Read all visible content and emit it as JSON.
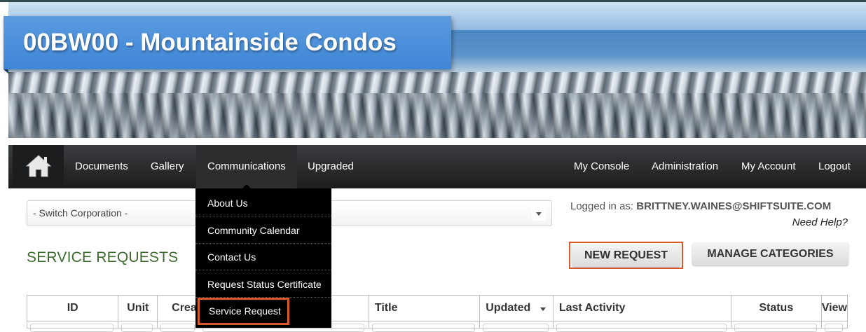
{
  "header": {
    "title": "00BW00 - Mountainside Condos"
  },
  "nav": {
    "home_icon": "home-icon",
    "left_items": [
      "Documents",
      "Gallery",
      "Communications",
      "Upgraded"
    ],
    "right_items": [
      "My Console",
      "Administration",
      "My Account",
      "Logout"
    ],
    "active": "Communications"
  },
  "dropdown": {
    "items": [
      "About Us",
      "Community Calendar",
      "Contact Us",
      "Request Status Certificate",
      "Service Request"
    ],
    "highlighted": "Service Request"
  },
  "corp_select": {
    "value": "- Switch Corporation -"
  },
  "user": {
    "logged_label": "Logged in as:",
    "email": "BRITTNEY.WAINES@SHIFTSUITE.COM",
    "help": "Need Help?"
  },
  "page": {
    "title": "SERVICE REQUESTS"
  },
  "buttons": {
    "new_request": "NEW REQUEST",
    "manage_categories": "MANAGE CATEGORIES"
  },
  "table": {
    "columns": [
      "ID",
      "Unit",
      "Crea",
      "",
      "Title",
      "Updated",
      "Last Activity",
      "Status",
      "View"
    ]
  },
  "colors": {
    "title_box": "#3f86d6",
    "highlight": "#d9592b",
    "page_title": "#3d6b2f",
    "nav_bg": "#2a2c2e"
  }
}
